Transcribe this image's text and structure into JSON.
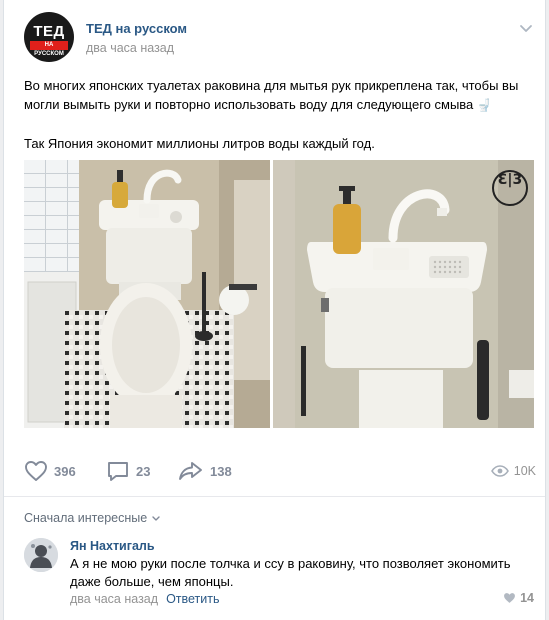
{
  "post": {
    "author": "ТЕД на русском",
    "time": "два часа назад",
    "avatar": {
      "logo_top": "ТЕД",
      "logo_bottom": "НА РУССКОМ",
      "brand_color": "#e0201b"
    },
    "text_paragraph_1": "Во многих японских туалетах раковина для мытья рук прикреплена так, чтобы вы могли вымыть руки и повторно использовать воду для следующего смыва",
    "text_paragraph_1_emoji": "🚽",
    "text_paragraph_2": "Так Япония экономит миллионы литров воды каждый год.",
    "photo_2_watermark": "Ɛ|3",
    "photos": [
      "toilet-sink-photo",
      "toilet-sink-closeup-photo"
    ]
  },
  "actions": {
    "likes": "396",
    "comments": "23",
    "shares": "138",
    "views": "10K"
  },
  "comments_section": {
    "sort_label": "Сначала интересные",
    "items": [
      {
        "author": "Ян Нахтигаль",
        "text": "А я не мою руки после толчка и ссу в раковину, что позволяет экономить даже больше, чем японцы.",
        "time": "два часа назад",
        "reply_label": "Ответить",
        "likes": "14"
      }
    ]
  },
  "colors": {
    "link": "#2a5885",
    "muted": "#939393",
    "icon": "#828a99",
    "background": "#edeef0"
  }
}
